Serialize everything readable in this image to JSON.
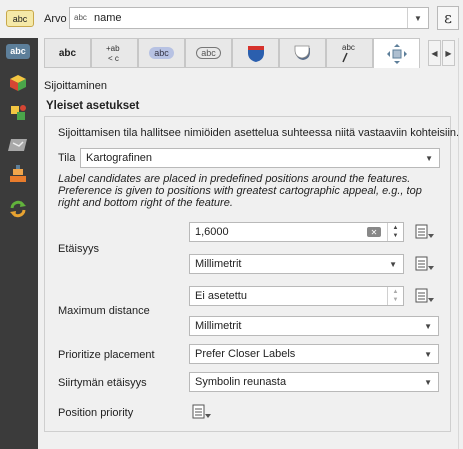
{
  "header": {
    "icon_text": "abc",
    "value_label": "Arvo",
    "value_icon_text": "abc",
    "value_field": "name",
    "expression_button": "ε"
  },
  "sidebar": {
    "items": [
      {
        "icon": "text-abc-icon",
        "text": "abc"
      },
      {
        "icon": "3d-box-icon"
      },
      {
        "icon": "rule-based-icon"
      },
      {
        "icon": "map-layer-icon"
      },
      {
        "icon": "stacked-labels-icon"
      },
      {
        "icon": "refresh-arrows-icon"
      }
    ]
  },
  "tabs": [
    {
      "name": "text-tab",
      "label": "abc"
    },
    {
      "name": "formatting-tab",
      "label": "+ab <c"
    },
    {
      "name": "buffer-tab",
      "label": "abc"
    },
    {
      "name": "mask-tab",
      "label": "abc"
    },
    {
      "name": "background-tab",
      "icon": "shield-icon"
    },
    {
      "name": "shadow-tab",
      "icon": "shadow-icon"
    },
    {
      "name": "callouts-tab",
      "label": "abc"
    },
    {
      "name": "placement-tab",
      "icon": "placement-icon",
      "active": true
    }
  ],
  "section": {
    "title": "Sijoittaminen",
    "group_title": "Yleiset asetukset"
  },
  "placement": {
    "description": "Sijoittamisen tila hallitsee nimiöiden asettelua suhteessa niitä vastaaviin kohteisiin.",
    "mode_label": "Tila",
    "mode_value": "Kartografinen",
    "mode_help": "Label candidates are placed in predefined positions around the features. Preference is given to positions with greatest cartographic appeal, e.g., top right and bottom right of the feature.",
    "distance_label": "Etäisyys",
    "distance_value": "1,6000",
    "distance_unit": "Millimetrit",
    "max_distance_label": "Maximum distance",
    "max_distance_value": "Ei asetettu",
    "max_distance_unit": "Millimetrit",
    "prioritize_label": "Prioritize placement",
    "prioritize_value": "Prefer Closer Labels",
    "offset_label": "Siirtymän etäisyys",
    "offset_value": "Symbolin reunasta",
    "position_priority_label": "Position priority"
  },
  "colors": {
    "sidebar_bg": "#3b3b3b",
    "panel_bg": "#f0f0f0",
    "accent_abc_bg": "#f5e9a8"
  }
}
